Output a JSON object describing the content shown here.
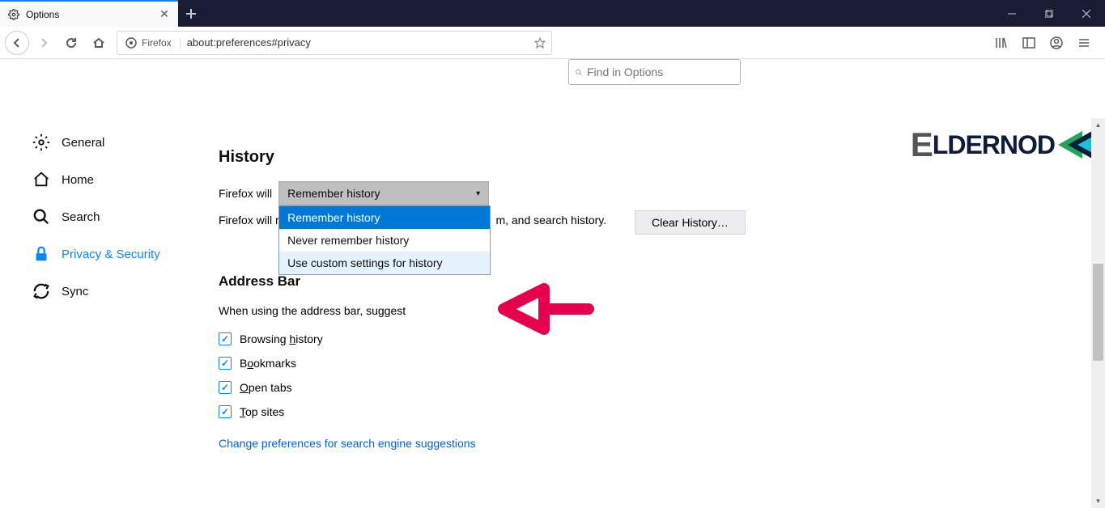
{
  "tab": {
    "title": "Options"
  },
  "url": {
    "identity": "Firefox",
    "value": "about:preferences#privacy"
  },
  "sidebar": {
    "items": [
      {
        "label": "General"
      },
      {
        "label": "Home"
      },
      {
        "label": "Search"
      },
      {
        "label": "Privacy & Security"
      },
      {
        "label": "Sync"
      }
    ]
  },
  "search": {
    "placeholder": "Find in Options"
  },
  "history": {
    "heading": "History",
    "label": "Firefox will",
    "selected": "Remember history",
    "options": [
      "Remember history",
      "Never remember history",
      "Use custom settings for history"
    ],
    "description_prefix": "Firefox will r",
    "description_suffix": "m, and search history.",
    "clear_button": "Clear History…"
  },
  "address_bar": {
    "heading": "Address Bar",
    "subtitle": "When using the address bar, suggest",
    "options": [
      {
        "label_pre": "Browsing ",
        "label_u": "h",
        "label_post": "istory"
      },
      {
        "label_pre": "B",
        "label_u": "o",
        "label_post": "okmarks"
      },
      {
        "label_pre": "",
        "label_u": "O",
        "label_post": "pen tabs"
      },
      {
        "label_pre": "",
        "label_u": "T",
        "label_post": "op sites"
      }
    ],
    "link": "Change preferences for search engine suggestions"
  },
  "watermark": {
    "e": "E",
    "rest": "LDERNOD"
  }
}
